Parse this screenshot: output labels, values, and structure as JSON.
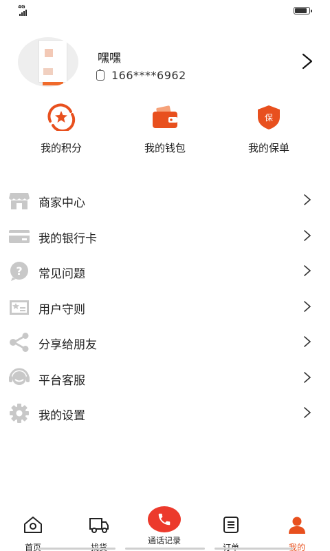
{
  "status_bar": {
    "network": "4G",
    "battery_level": 0.85
  },
  "profile": {
    "name": "嘿嘿",
    "phone": "166****6962"
  },
  "quick_actions": [
    {
      "label": "我的积分",
      "icon": "points-icon"
    },
    {
      "label": "我的钱包",
      "icon": "wallet-icon"
    },
    {
      "label": "我的保单",
      "icon": "insurance-icon"
    }
  ],
  "menu": [
    {
      "label": "商家中心",
      "icon": "store-icon"
    },
    {
      "label": "我的银行卡",
      "icon": "bank-card-icon"
    },
    {
      "label": "常见问题",
      "icon": "question-icon"
    },
    {
      "label": "用户守则",
      "icon": "rules-icon"
    },
    {
      "label": "分享给朋友",
      "icon": "share-icon"
    },
    {
      "label": "平台客服",
      "icon": "customer-service-icon"
    },
    {
      "label": "我的设置",
      "icon": "settings-icon"
    }
  ],
  "tabs": [
    {
      "label": "首页",
      "icon": "home-icon"
    },
    {
      "label": "找货",
      "icon": "truck-icon"
    },
    {
      "label": "通话记录",
      "icon": "phone-call-icon"
    },
    {
      "label": "订单",
      "icon": "order-icon"
    },
    {
      "label": "我的",
      "icon": "user-icon"
    }
  ],
  "active_tab": "我的",
  "colors": {
    "accent": "#E8501E",
    "call": "#EC3A2C",
    "icon_gray": "#C8C8C8"
  }
}
